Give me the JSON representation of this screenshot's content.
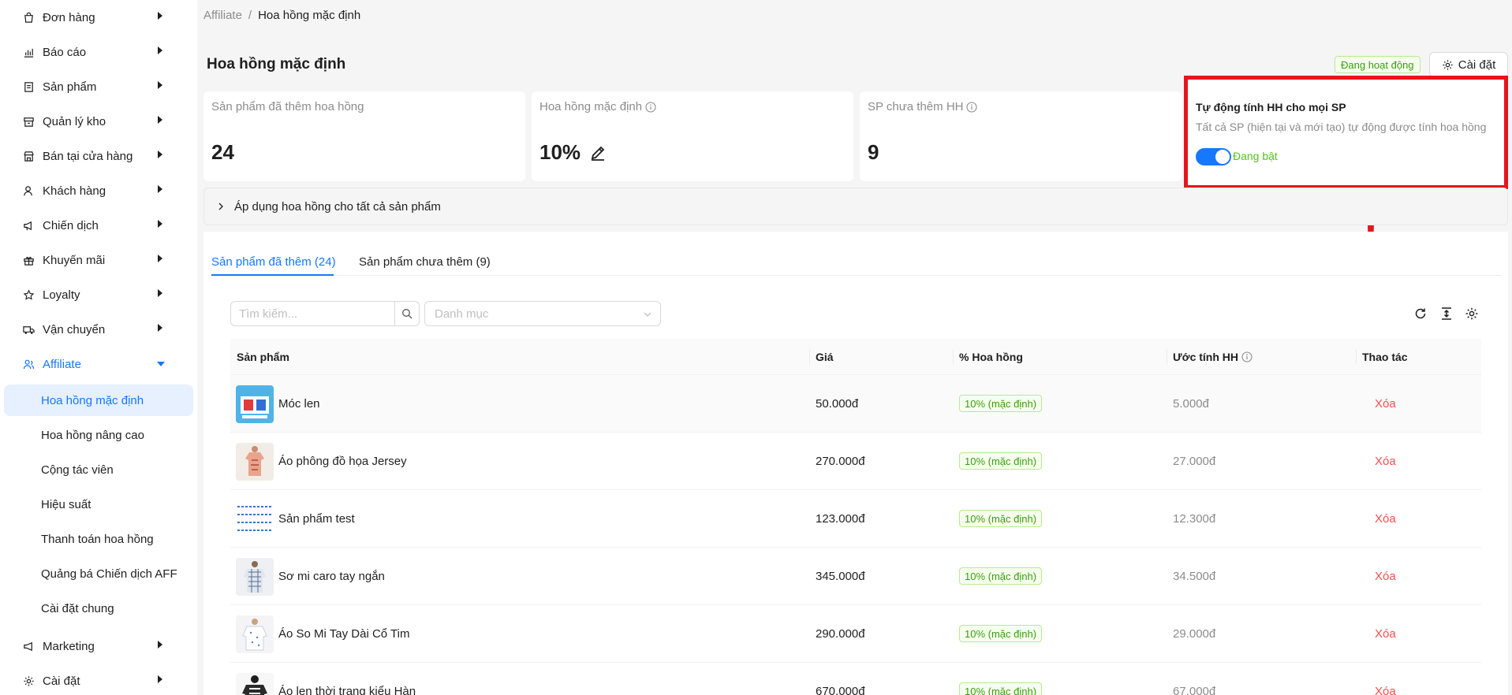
{
  "sidebar": {
    "items": [
      {
        "label": "Đơn hàng",
        "icon": "shopping-bag-icon"
      },
      {
        "label": "Báo cáo",
        "icon": "bar-chart-icon"
      },
      {
        "label": "Sản phẩm",
        "icon": "product-list-icon"
      },
      {
        "label": "Quản lý kho",
        "icon": "inventory-box-icon"
      },
      {
        "label": "Bán tại cửa hàng",
        "icon": "store-icon"
      },
      {
        "label": "Khách hàng",
        "icon": "customers-icon"
      },
      {
        "label": "Chiến dịch",
        "icon": "megaphone-icon"
      },
      {
        "label": "Khuyến mãi",
        "icon": "gift-icon"
      },
      {
        "label": "Loyalty",
        "icon": "star-icon"
      },
      {
        "label": "Vận chuyển",
        "icon": "truck-icon"
      },
      {
        "label": "Affiliate",
        "icon": "affiliate-icon"
      }
    ],
    "affiliate_sub": [
      "Hoa hồng mặc định",
      "Hoa hồng nâng cao",
      "Cộng tác viên",
      "Hiệu suất",
      "Thanh toán hoa hồng",
      "Quảng bá Chiến dịch AFF",
      "Cài đặt chung"
    ],
    "bottom_items": [
      {
        "label": "Marketing",
        "icon": "marketing-icon"
      },
      {
        "label": "Cài đặt",
        "icon": "gear-icon"
      }
    ]
  },
  "breadcrumb": {
    "parent": "Affiliate",
    "separator": "/",
    "current": "Hoa hồng mặc định"
  },
  "header": {
    "title": "Hoa hồng mặc định",
    "status": "Đang hoạt động",
    "settings_label": "Cài đặt"
  },
  "stats": [
    {
      "label": "Sản phẩm đã thêm hoa hồng",
      "value": "24"
    },
    {
      "label": "Hoa hồng mặc định",
      "value": "10%"
    },
    {
      "label": "SP chưa thêm HH",
      "value": "9"
    }
  ],
  "auto_commission": {
    "title": "Tự động tính HH cho mọi SP",
    "description": "Tất cả SP (hiện tại và mới tạo) tự động được tính hoa hồng",
    "toggle_on": true,
    "toggle_label": "Đang bật"
  },
  "apply_all": {
    "label": "Áp dụng hoa hồng cho tất cả sản phẩm"
  },
  "tabs": [
    {
      "label": "Sản phẩm đã thêm (24)",
      "active": true
    },
    {
      "label": "Sản phẩm chưa thêm (9)",
      "active": false
    }
  ],
  "filters": {
    "search_placeholder": "Tìm kiếm...",
    "category_placeholder": "Danh mục"
  },
  "table": {
    "headers": {
      "product": "Sản phẩm",
      "price": "Giá",
      "rate": "% Hoa hồng",
      "estimate": "Ước tính HH",
      "actions": "Thao tác"
    },
    "rows": [
      {
        "name": "Móc len",
        "price": "50.000đ",
        "rate": "10% (mặc định)",
        "estimate": "5.000đ",
        "action": "Xóa"
      },
      {
        "name": "Áo phông đồ họa Jersey",
        "price": "270.000đ",
        "rate": "10% (mặc định)",
        "estimate": "27.000đ",
        "action": "Xóa"
      },
      {
        "name": "Sản phẩm test",
        "price": "123.000đ",
        "rate": "10% (mặc định)",
        "estimate": "12.300đ",
        "action": "Xóa"
      },
      {
        "name": "Sơ mi caro tay ngắn",
        "price": "345.000đ",
        "rate": "10% (mặc định)",
        "estimate": "34.500đ",
        "action": "Xóa"
      },
      {
        "name": "Áo So Mi Tay Dài Cổ Tim",
        "price": "290.000đ",
        "rate": "10% (mặc định)",
        "estimate": "29.000đ",
        "action": "Xóa"
      },
      {
        "name": "Áo len thời trang kiểu Hàn",
        "price": "670.000đ",
        "rate": "10% (mặc định)",
        "estimate": "67.000đ",
        "action": "Xóa"
      }
    ]
  },
  "colors": {
    "accent": "#1677ff",
    "success": "#52c41a",
    "danger": "#ff4d4f",
    "highlight_border": "#e8141c"
  }
}
